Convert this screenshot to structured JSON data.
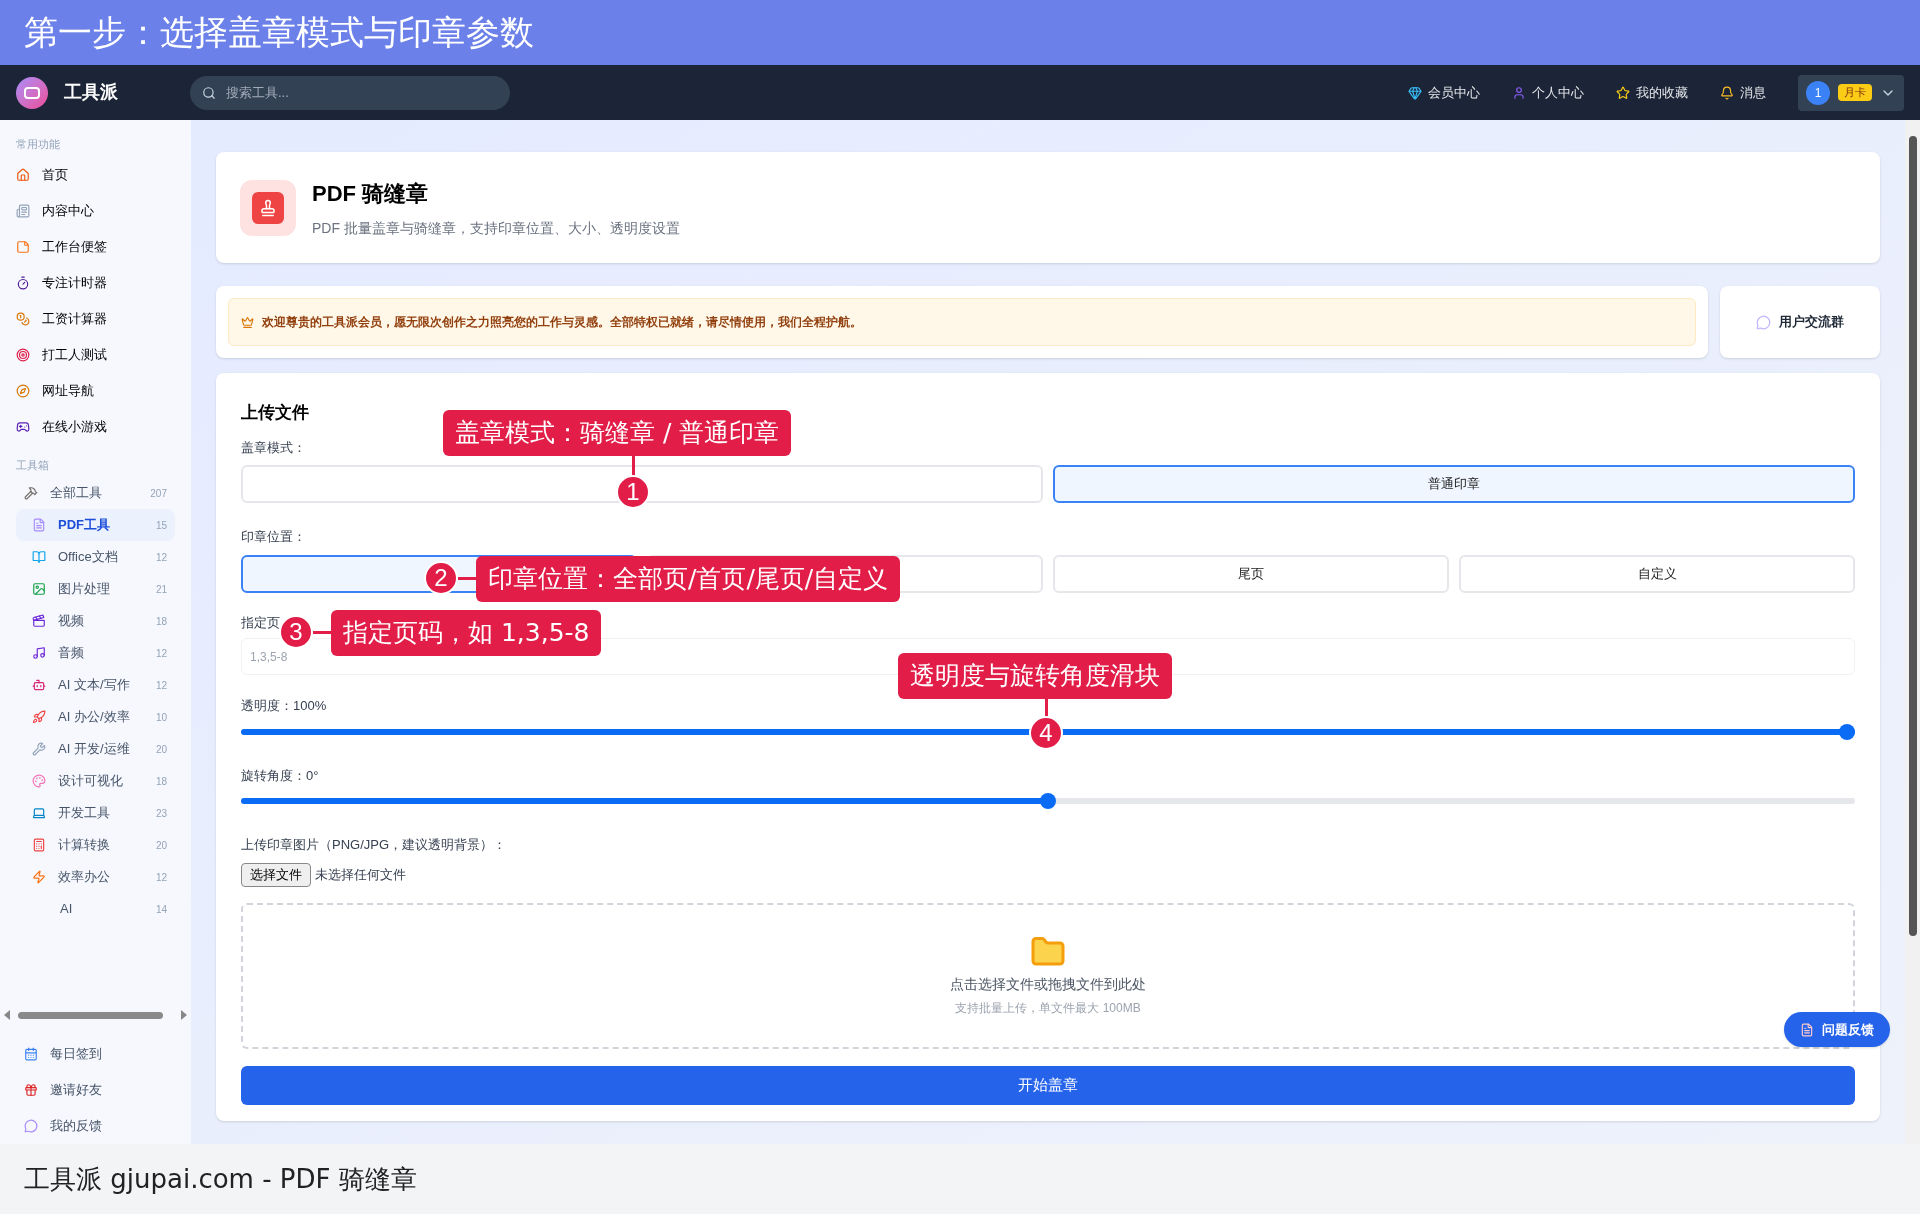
{
  "banner": {
    "title": "第一步：选择盖章模式与印章参数"
  },
  "navbar": {
    "brand": "工具派",
    "search_placeholder": "搜索工具...",
    "links": [
      "会员中心",
      "个人中心",
      "我的收藏",
      "消息"
    ],
    "user": {
      "avatar": "1",
      "badge": "月卡"
    }
  },
  "sidebar": {
    "sections": [
      {
        "title": "常用功能",
        "items": [
          {
            "label": "首页",
            "selected": false
          },
          {
            "label": "内容中心",
            "selected": false
          },
          {
            "label": "工作台便签",
            "selected": false
          },
          {
            "label": "专注计时器",
            "selected": false
          },
          {
            "label": "工资计算器",
            "selected": false
          },
          {
            "label": "打工人测试",
            "selected": false
          },
          {
            "label": "网址导航",
            "selected": false
          },
          {
            "label": "在线小游戏",
            "selected": false
          }
        ]
      },
      {
        "title": "工具箱",
        "items": [
          {
            "label": "全部工具",
            "count": "207",
            "selected": false
          },
          {
            "label": "PDF工具",
            "count": "15",
            "selected": true
          },
          {
            "label": "Office文档",
            "count": "12",
            "selected": false
          },
          {
            "label": "图片处理",
            "count": "21",
            "selected": false
          },
          {
            "label": "视频",
            "count": "18",
            "selected": false
          },
          {
            "label": "音频",
            "count": "12",
            "selected": false
          },
          {
            "label": "AI 文本/写作",
            "count": "12",
            "selected": false
          },
          {
            "label": "AI 办公/效率",
            "count": "10",
            "selected": false
          },
          {
            "label": "AI 开发/运维",
            "count": "20",
            "selected": false
          },
          {
            "label": "设计可视化",
            "count": "18",
            "selected": false
          },
          {
            "label": "开发工具",
            "count": "23",
            "selected": false
          },
          {
            "label": "计算转换",
            "count": "20",
            "selected": false
          },
          {
            "label": "效率办公",
            "count": "12",
            "selected": false
          },
          {
            "label": "AI",
            "count": "14",
            "selected": false
          }
        ]
      }
    ],
    "footer_items": [
      "每日签到",
      "邀请好友",
      "我的反馈"
    ]
  },
  "tool": {
    "title": "PDF 骑缝章",
    "description": "PDF 批量盖章与骑缝章，支持印章位置、大小、透明度设置"
  },
  "welcome": {
    "message": "欢迎尊贵的工具派会员，愿无限次创作之力照亮您的工作与灵感。全部特权已就绪，请尽情使用，我们全程护航。",
    "group_button": "用户交流群"
  },
  "form": {
    "title": "上传文件",
    "mode_label": "盖章模式：",
    "modes": [
      {
        "selected": false
      },
      {
        "label": "普通印章",
        "selected": true
      }
    ],
    "position_label": "印章位置：",
    "positions": [
      {
        "selected": true
      },
      {
        "selected": false
      },
      {
        "label": "尾页",
        "selected": false
      },
      {
        "label": "自定义",
        "selected": false
      }
    ],
    "pages_label": "指定页",
    "pages_placeholder": "1,3,5-8",
    "opacity": {
      "label": "透明度：100%",
      "level": 1.0
    },
    "rotation": {
      "label": "旋转角度：0°",
      "level": 0.5
    },
    "stamp_label": "上传印章图片（PNG/JPG，建议透明背景）：",
    "file_button": "选择文件",
    "file_status": "未选择任何文件",
    "dropzone": {
      "title": "点击选择文件或拖拽文件到此处",
      "hint": "支持批量上传，单文件最大 100MB"
    },
    "submit": "开始盖章"
  },
  "feedback_button": "问题反馈",
  "annotations": [
    {
      "number": "1",
      "text": "盖章模式：骑缝章 / 普通印章"
    },
    {
      "number": "2",
      "text": "印章位置：全部页/首页/尾页/自定义"
    },
    {
      "number": "3",
      "text": "指定页码，如 1,3,5-8"
    },
    {
      "number": "4",
      "text": "透明度与旋转角度滑块"
    }
  ],
  "caption": "工具派 gjupai.com - PDF 骑缝章"
}
